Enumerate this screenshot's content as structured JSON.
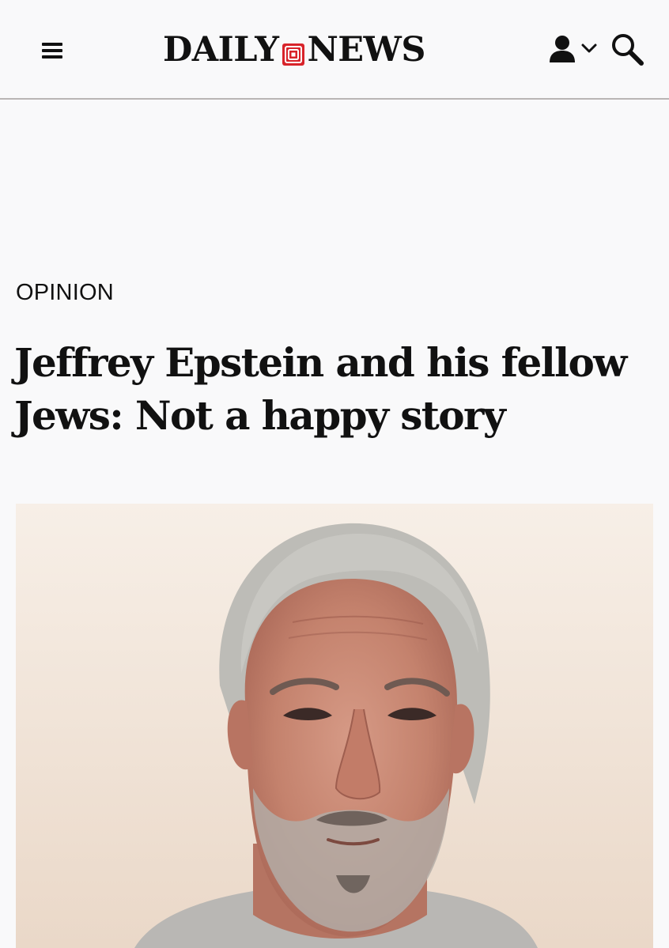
{
  "header": {
    "logo": {
      "left_word": "DAILY",
      "right_word": "NEWS"
    },
    "icons": {
      "menu": "hamburger-menu-icon",
      "account": "user-icon",
      "dropdown": "chevron-down-icon",
      "search": "search-icon"
    }
  },
  "article": {
    "section": "OPINION",
    "headline": "Jeffrey Epstein and his fellow Jews: Not a happy story"
  },
  "colors": {
    "brand_red": "#d8232a",
    "text": "#111111",
    "background": "#f9f9fa",
    "divider": "#b9b5b4"
  }
}
